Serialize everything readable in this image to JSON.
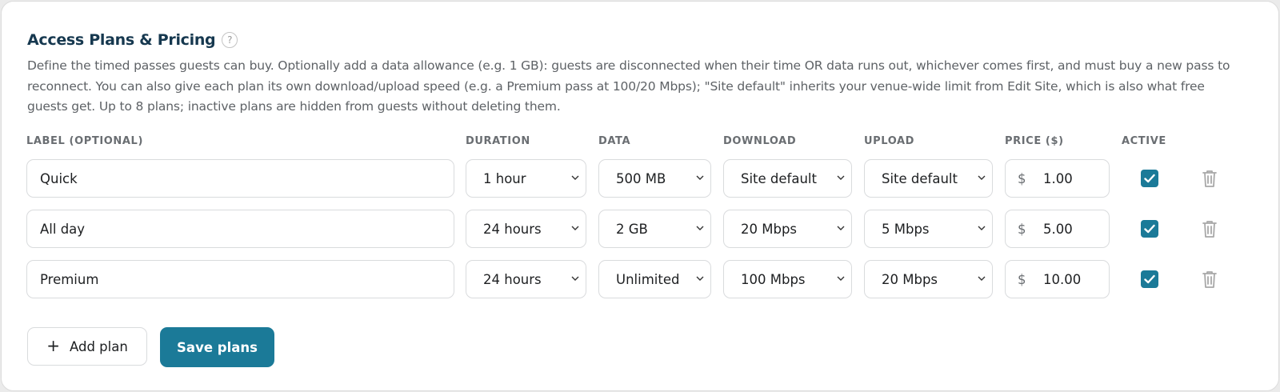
{
  "section": {
    "title": "Access Plans & Pricing",
    "help_glyph": "?",
    "description": "Define the timed passes guests can buy. Optionally add a data allowance (e.g. 1 GB): guests are disconnected when their time OR data runs out, whichever comes first, and must buy a new pass to reconnect. You can also give each plan its own download/upload speed (e.g. a Premium pass at 100/20 Mbps); \"Site default\" inherits your venue-wide limit from Edit Site, which is also what free guests get. Up to 8 plans; inactive plans are hidden from guests without deleting them."
  },
  "columns": {
    "label": "LABEL (OPTIONAL)",
    "duration": "DURATION",
    "data": "DATA",
    "download": "DOWNLOAD",
    "upload": "UPLOAD",
    "price": "PRICE ($)",
    "active": "ACTIVE"
  },
  "plans": [
    {
      "label": "Quick",
      "duration": "1 hour",
      "data": "500 MB",
      "download": "Site default",
      "upload": "Site default",
      "currency": "$",
      "price": "1.00",
      "active": true
    },
    {
      "label": "All day",
      "duration": "24 hours",
      "data": "2 GB",
      "download": "20 Mbps",
      "upload": "5 Mbps",
      "currency": "$",
      "price": "5.00",
      "active": true
    },
    {
      "label": "Premium",
      "duration": "24 hours",
      "data": "Unlimited",
      "download": "100 Mbps",
      "upload": "20 Mbps",
      "currency": "$",
      "price": "10.00",
      "active": true
    }
  ],
  "actions": {
    "add_icon": "+",
    "add_label": "Add plan",
    "save_label": "Save plans"
  },
  "colors": {
    "accent": "#1b7a98",
    "title": "#16384f",
    "muted_text": "#5e6266",
    "border": "#d9dbdd",
    "trash_icon": "#a8a8a8"
  },
  "icons": {
    "help": "help-icon",
    "select_chevron": "chevron-down-icon",
    "active_check": "checkmark-icon",
    "delete": "trash-icon",
    "add": "plus-icon"
  }
}
